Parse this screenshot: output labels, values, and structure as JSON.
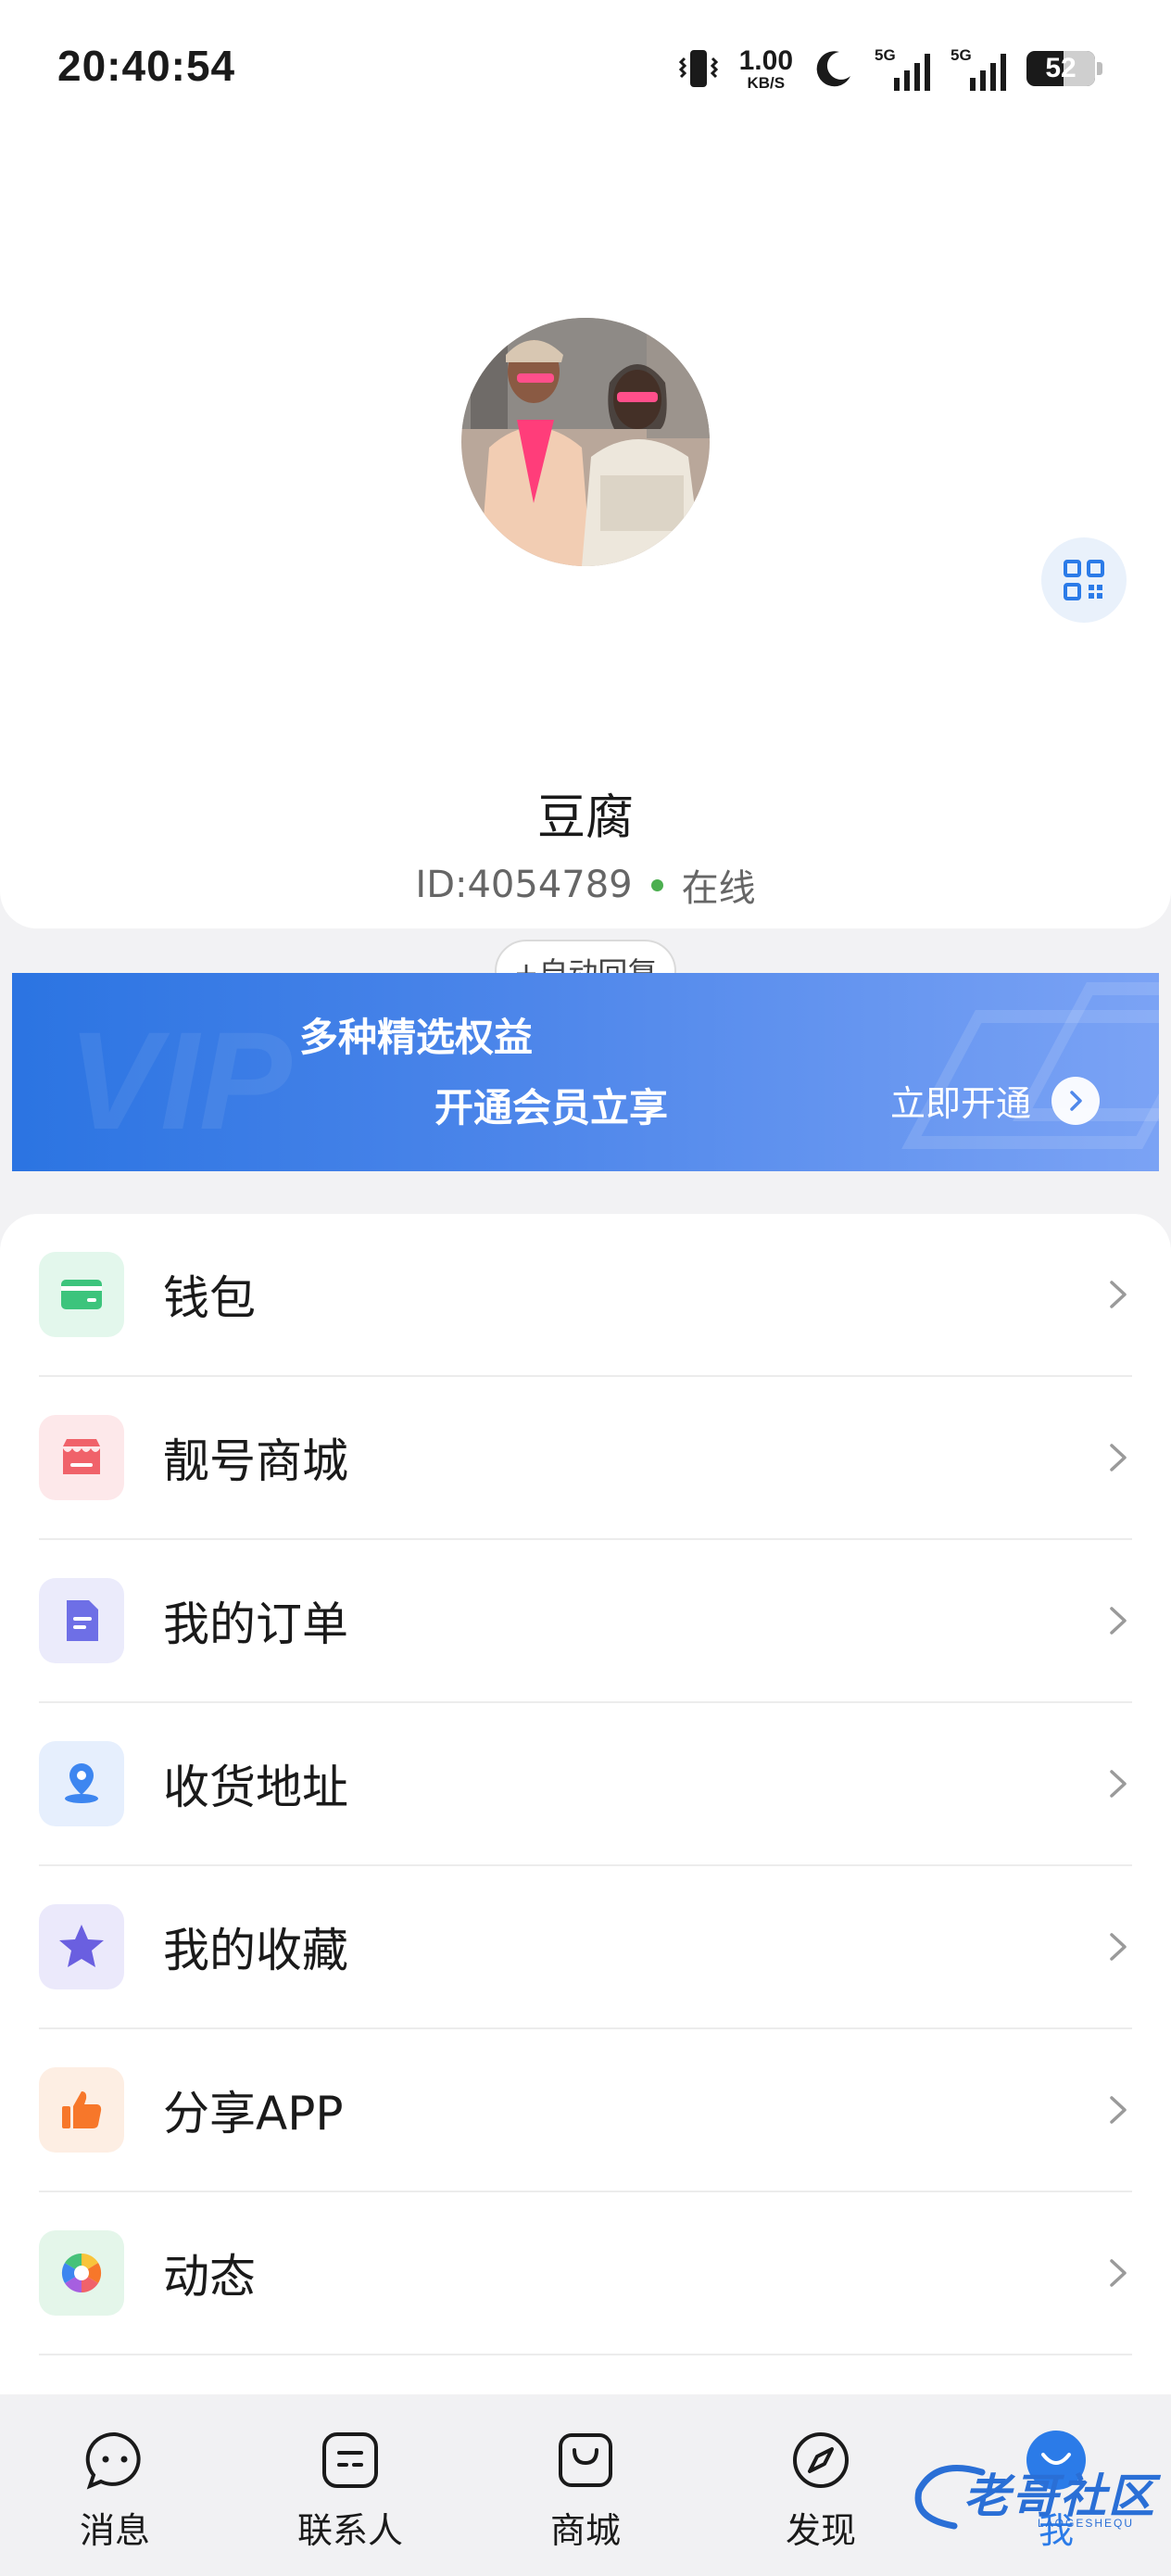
{
  "status_bar": {
    "time": "20:40:54",
    "net_speed_value": "1.00",
    "net_speed_unit": "KB/S",
    "signal1_tag": "5G",
    "signal2_tag": "5G",
    "battery": "52"
  },
  "profile": {
    "username": "豆腐",
    "id_text": "ID:4054789",
    "status": "在线",
    "auto_reply_label": "+自动回复"
  },
  "vip_banner": {
    "line1": "多种精选权益",
    "line2": "开通会员立享",
    "cta": "立即开通",
    "deco": "VIP"
  },
  "menu": [
    {
      "label": "钱包",
      "icon": "wallet-icon",
      "color": "#3cc47c",
      "bg": "#e3f7ec"
    },
    {
      "label": "靓号商城",
      "icon": "shop-icon",
      "color": "#f0626a",
      "bg": "#fde8ea"
    },
    {
      "label": "我的订单",
      "icon": "order-doc-icon",
      "color": "#6e6fe6",
      "bg": "#ebebfb"
    },
    {
      "label": "收货地址",
      "icon": "location-pin-icon",
      "color": "#3d86f0",
      "bg": "#e6effd"
    },
    {
      "label": "我的收藏",
      "icon": "star-icon",
      "color": "#6a5fe0",
      "bg": "#ebe9fb"
    },
    {
      "label": "分享APP",
      "icon": "thumbs-up-icon",
      "color": "#f7772a",
      "bg": "#fdeee3"
    },
    {
      "label": "动态",
      "icon": "aperture-icon",
      "color": "#46c27a",
      "bg": "#e4f6ea"
    }
  ],
  "bottom_nav": [
    {
      "label": "消息",
      "icon": "message-bubble-icon"
    },
    {
      "label": "联系人",
      "icon": "contacts-icon"
    },
    {
      "label": "商城",
      "icon": "shopping-bag-icon"
    },
    {
      "label": "发现",
      "icon": "compass-icon"
    },
    {
      "label": "我",
      "icon": "me-face-icon"
    }
  ],
  "watermark": {
    "text": "老哥社区",
    "sub": "LAOGESHEQU"
  },
  "colors": {
    "accent": "#2b7be8",
    "online": "#4caf50"
  }
}
